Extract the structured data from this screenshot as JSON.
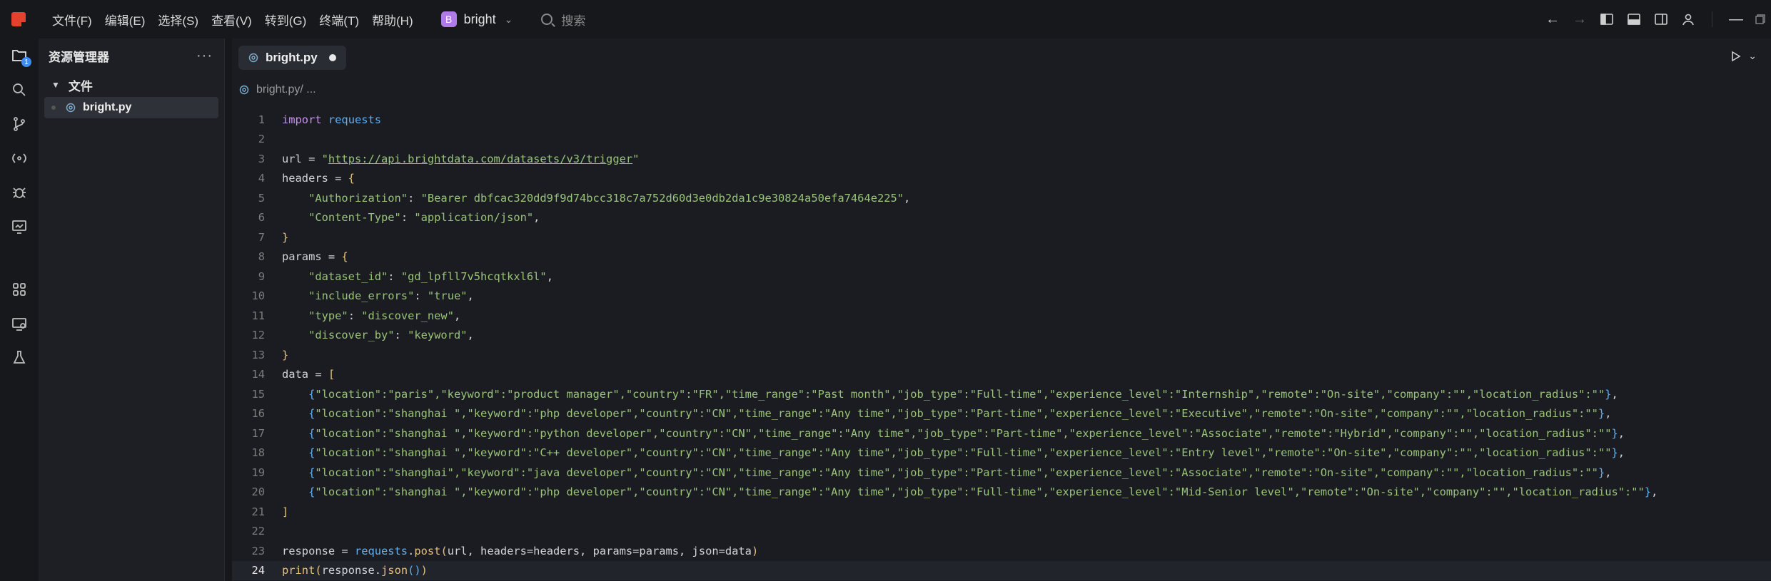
{
  "menu": [
    "文件(F)",
    "编辑(E)",
    "选择(S)",
    "查看(V)",
    "转到(G)",
    "终端(T)",
    "帮助(H)"
  ],
  "project": {
    "initial": "B",
    "name": "bright"
  },
  "search": {
    "placeholder": "搜索"
  },
  "explorer": {
    "title": "资源管理器",
    "folder": "文件",
    "file": "bright.py"
  },
  "activity_badge": "1",
  "tab": {
    "name": "bright.py"
  },
  "breadcrumb": {
    "file": "bright.py",
    "rest": " / ..."
  },
  "code": {
    "current_line": 24,
    "lines": [
      [
        [
          "kw",
          "import"
        ],
        [
          "src",
          " "
        ],
        [
          "fn",
          "requests"
        ]
      ],
      [],
      [
        [
          "src",
          "url = "
        ],
        [
          "str",
          "\""
        ],
        [
          "str url",
          "https://api.brightdata.com/datasets/v3/trigger"
        ],
        [
          "str",
          "\""
        ]
      ],
      [
        [
          "src",
          "headers = "
        ],
        [
          "brk",
          "{"
        ]
      ],
      [
        [
          "src",
          "    "
        ],
        [
          "str",
          "\"Authorization\""
        ],
        [
          "src",
          ": "
        ],
        [
          "str",
          "\"Bearer dbfcac320dd9f9d74bcc318c7a752d60d3e0db2da1c9e30824a50efa7464e225\""
        ],
        [
          "src",
          ","
        ]
      ],
      [
        [
          "src",
          "    "
        ],
        [
          "str",
          "\"Content-Type\""
        ],
        [
          "src",
          ": "
        ],
        [
          "str",
          "\"application/json\""
        ],
        [
          "src",
          ","
        ]
      ],
      [
        [
          "brk",
          "}"
        ]
      ],
      [
        [
          "src",
          "params = "
        ],
        [
          "brk",
          "{"
        ]
      ],
      [
        [
          "src",
          "    "
        ],
        [
          "str",
          "\"dataset_id\""
        ],
        [
          "src",
          ": "
        ],
        [
          "str",
          "\"gd_lpfll7v5hcqtkxl6l\""
        ],
        [
          "src",
          ","
        ]
      ],
      [
        [
          "src",
          "    "
        ],
        [
          "str",
          "\"include_errors\""
        ],
        [
          "src",
          ": "
        ],
        [
          "str",
          "\"true\""
        ],
        [
          "src",
          ","
        ]
      ],
      [
        [
          "src",
          "    "
        ],
        [
          "str",
          "\"type\""
        ],
        [
          "src",
          ": "
        ],
        [
          "str",
          "\"discover_new\""
        ],
        [
          "src",
          ","
        ]
      ],
      [
        [
          "src",
          "    "
        ],
        [
          "str",
          "\"discover_by\""
        ],
        [
          "src",
          ": "
        ],
        [
          "str",
          "\"keyword\""
        ],
        [
          "src",
          ","
        ]
      ],
      [
        [
          "brk",
          "}"
        ]
      ],
      [
        [
          "src",
          "data = "
        ],
        [
          "brk",
          "["
        ]
      ],
      [
        [
          "src",
          "    "
        ],
        [
          "fn",
          "{"
        ],
        [
          "str",
          "\"location\":\"paris\",\"keyword\":\"product manager\",\"country\":\"FR\",\"time_range\":\"Past month\",\"job_type\":\"Full-time\",\"experience_level\":\"Internship\",\"remote\":\"On-site\",\"company\":\"\",\"location_radius\":\"\""
        ],
        [
          "fn",
          "}"
        ],
        [
          "src",
          ","
        ]
      ],
      [
        [
          "src",
          "    "
        ],
        [
          "fn",
          "{"
        ],
        [
          "str",
          "\"location\":\"shanghai \",\"keyword\":\"php developer\",\"country\":\"CN\",\"time_range\":\"Any time\",\"job_type\":\"Part-time\",\"experience_level\":\"Executive\",\"remote\":\"On-site\",\"company\":\"\",\"location_radius\":\"\""
        ],
        [
          "fn",
          "}"
        ],
        [
          "src",
          ","
        ]
      ],
      [
        [
          "src",
          "    "
        ],
        [
          "fn",
          "{"
        ],
        [
          "str",
          "\"location\":\"shanghai \",\"keyword\":\"python developer\",\"country\":\"CN\",\"time_range\":\"Any time\",\"job_type\":\"Part-time\",\"experience_level\":\"Associate\",\"remote\":\"Hybrid\",\"company\":\"\",\"location_radius\":\"\""
        ],
        [
          "fn",
          "}"
        ],
        [
          "src",
          ","
        ]
      ],
      [
        [
          "src",
          "    "
        ],
        [
          "fn",
          "{"
        ],
        [
          "str",
          "\"location\":\"shanghai \",\"keyword\":\"C++ developer\",\"country\":\"CN\",\"time_range\":\"Any time\",\"job_type\":\"Full-time\",\"experience_level\":\"Entry level\",\"remote\":\"On-site\",\"company\":\"\",\"location_radius\":\"\""
        ],
        [
          "fn",
          "}"
        ],
        [
          "src",
          ","
        ]
      ],
      [
        [
          "src",
          "    "
        ],
        [
          "fn",
          "{"
        ],
        [
          "str",
          "\"location\":\"shanghai\",\"keyword\":\"java developer\",\"country\":\"CN\",\"time_range\":\"Any time\",\"job_type\":\"Part-time\",\"experience_level\":\"Associate\",\"remote\":\"On-site\",\"company\":\"\",\"location_radius\":\"\""
        ],
        [
          "fn",
          "}"
        ],
        [
          "src",
          ","
        ]
      ],
      [
        [
          "src",
          "    "
        ],
        [
          "fn",
          "{"
        ],
        [
          "str",
          "\"location\":\"shanghai \",\"keyword\":\"php developer\",\"country\":\"CN\",\"time_range\":\"Any time\",\"job_type\":\"Full-time\",\"experience_level\":\"Mid-Senior level\",\"remote\":\"On-site\",\"company\":\"\",\"location_radius\":\"\""
        ],
        [
          "fn",
          "}"
        ],
        [
          "src",
          ","
        ]
      ],
      [
        [
          "brk",
          "]"
        ]
      ],
      [],
      [
        [
          "src",
          "response = "
        ],
        [
          "fn",
          "requests"
        ],
        [
          "src",
          "."
        ],
        [
          "brk",
          "post"
        ],
        [
          "brk",
          "("
        ],
        [
          "src",
          "url, headers=headers, params=params, json=data"
        ],
        [
          "brk",
          ")"
        ]
      ],
      [
        [
          "brk",
          "print"
        ],
        [
          "brk",
          "("
        ],
        [
          "src",
          "response."
        ],
        [
          "brk",
          "json"
        ],
        [
          "fn",
          "()"
        ],
        [
          "brk",
          ")"
        ]
      ]
    ]
  }
}
